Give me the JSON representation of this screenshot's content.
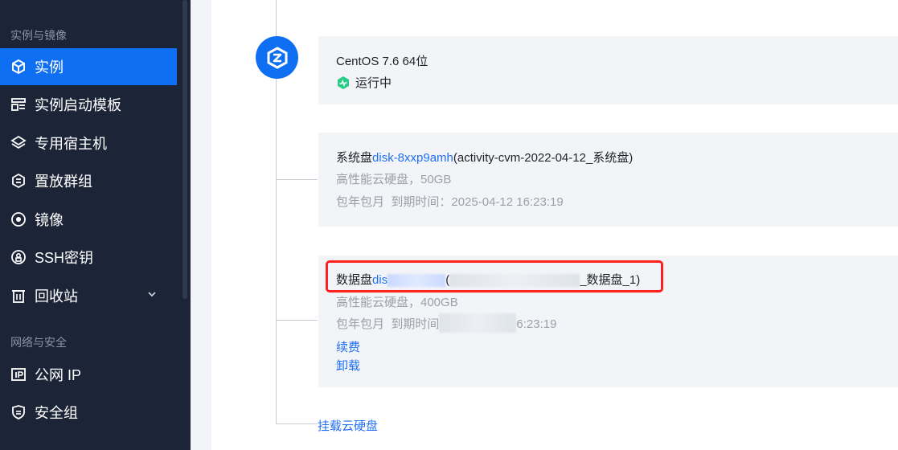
{
  "sidebar": {
    "group1_label": "实例与镜像",
    "items": [
      {
        "label": "实例",
        "icon": "instance-icon"
      },
      {
        "label": "实例启动模板",
        "icon": "template-icon"
      },
      {
        "label": "专用宿主机",
        "icon": "layers-icon"
      },
      {
        "label": "置放群组",
        "icon": "placement-icon"
      },
      {
        "label": "镜像",
        "icon": "image-icon"
      },
      {
        "label": "SSH密钥",
        "icon": "key-icon"
      },
      {
        "label": "回收站",
        "icon": "trash-icon"
      }
    ],
    "group2_label": "网络与安全",
    "items2": [
      {
        "label": "公网 IP",
        "icon": "ip-icon"
      },
      {
        "label": "安全组",
        "icon": "shield-icon"
      }
    ]
  },
  "instance": {
    "os": "CentOS 7.6 64位",
    "status": "运行中"
  },
  "system_disk": {
    "prefix": "系统盘",
    "disk_id": "disk-8xxp9amh",
    "name": "(activity-cvm-2022-04-12_系统盘)",
    "type": "高性能云硬盘，50GB",
    "billing": "包年包月",
    "expire_label": "到期时间：",
    "expire_time": "2025-04-12 16:23:19"
  },
  "data_disk": {
    "prefix": "数据盘",
    "disk_id_visible": "dis",
    "name_open": "(",
    "name_suffix": "_数据盘_1)",
    "type": "高性能云硬盘，400GB",
    "billing": "包年包月",
    "expire_label": "到期时间",
    "expire_time_visible": "6:23:19",
    "renew": "续费",
    "unmount": "卸载"
  },
  "mount_link": "挂载云硬盘",
  "colors": {
    "sidebar_bg": "#1c2538",
    "active": "#0f6ff2",
    "link": "#1f6ff2",
    "highlight": "#ff1f1f",
    "status_green": "#29cc85"
  }
}
